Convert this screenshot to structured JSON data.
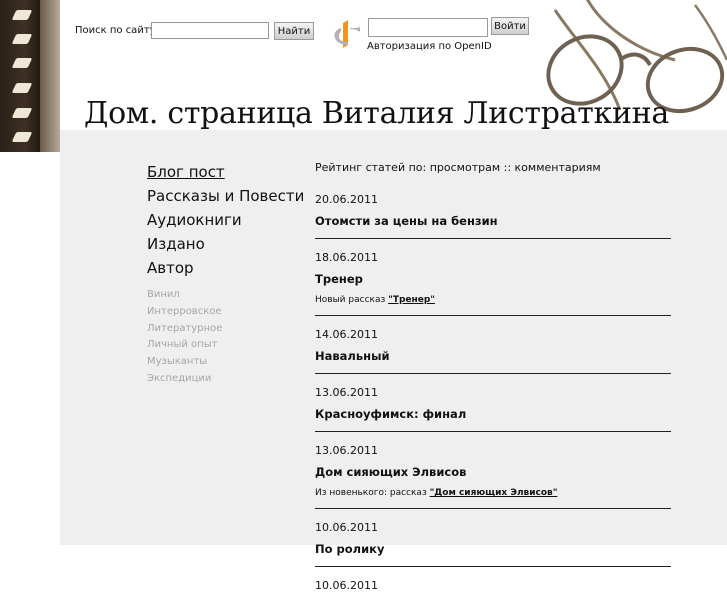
{
  "search": {
    "label": "Поиск по сайту:",
    "button": "Найти",
    "value": ""
  },
  "openid": {
    "button": "Войти",
    "caption": "Авторизация по OpenID",
    "value": ""
  },
  "title": "Дом. страница Виталия Листраткина",
  "nav": [
    {
      "label": "Блог пост",
      "active": true
    },
    {
      "label": "Рассказы и Повести"
    },
    {
      "label": "Аудиокниги"
    },
    {
      "label": "Издано"
    },
    {
      "label": "Автор"
    }
  ],
  "tags": [
    "Винил",
    "Интерровское",
    "Литературное",
    "Личный опыт",
    "Музыканты",
    "Экспедиции"
  ],
  "rating": "Рейтинг статей по: просмотрам :: комментариям",
  "posts": [
    {
      "date": "20.06.2011",
      "title": "Отомсти за цены на бензин"
    },
    {
      "date": "18.06.2011",
      "title": "Тренер",
      "excerpt_prefix": "Новый рассказ ",
      "excerpt_link": "\"Тренер\""
    },
    {
      "date": "14.06.2011",
      "title": "Навальный"
    },
    {
      "date": "13.06.2011",
      "title": "Красноуфимск: финал"
    },
    {
      "date": "13.06.2011",
      "title": "Дом сияющих Элвисов",
      "excerpt_prefix": "Из новенького: рассказ ",
      "excerpt_link": "\"Дом сияющих Элвисов\""
    },
    {
      "date": "10.06.2011",
      "title": "По ролику"
    },
    {
      "date": "10.06.2011",
      "title": ""
    }
  ]
}
